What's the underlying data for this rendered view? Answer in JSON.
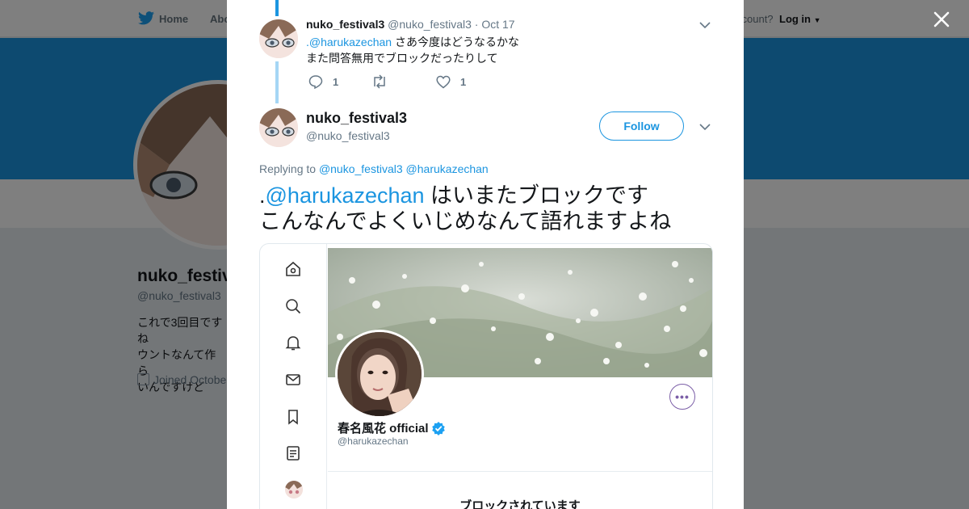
{
  "nav": {
    "home_label": "Home",
    "about_label": "Abo",
    "account_prompt": "ccount?",
    "login_label": "Log in"
  },
  "background_profile": {
    "name": "nuko_festiv",
    "handle": "@nuko_festival3",
    "bio": "これで3回目ですね\nウントなんて作ら\nいんですけど",
    "joined": "Joined Octobe",
    "banner_color": "#1b95e0"
  },
  "modal": {
    "parent_tweet": {
      "name": "nuko_festival3",
      "handle": "@nuko_festival3",
      "date": "· Oct 17",
      "mention": ".@harukazechan",
      "text_line1": " さあ今度はどうなるかな",
      "text_line2": "また問答無用でブロックだったりして",
      "reply_count": "1",
      "like_count": "1"
    },
    "main_tweet": {
      "name": "nuko_festival3",
      "handle": "@nuko_festival3",
      "follow_label": "Follow",
      "replying_prefix": "Replying to ",
      "replying_to_1": "@nuko_festival3",
      "replying_to_2": "@harukazechan",
      "text_prefix": ".",
      "text_mention": "@harukazechan",
      "text_line1": " はいまたブロックです",
      "text_line2": "こんなんでよくいじめなんて語れますよね"
    },
    "embedded_screenshot": {
      "profile_name": "春名風花 official",
      "profile_handle": "@harukazechan",
      "blocked_heading": "ブロックされています",
      "accent_color": "#7b5ea7"
    }
  },
  "colors": {
    "link": "#1b95e0",
    "muted": "#657786"
  }
}
